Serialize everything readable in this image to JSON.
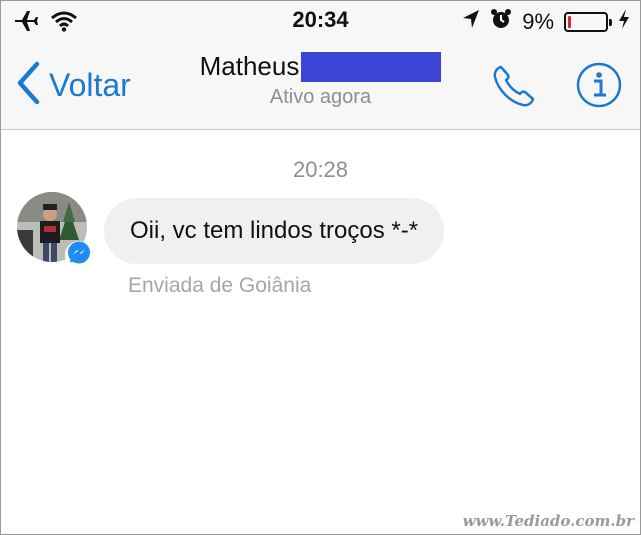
{
  "status_bar": {
    "time": "20:34",
    "battery_percent_text": "9%",
    "battery_level": 0.09,
    "icons": [
      "airplane-icon",
      "wifi-icon",
      "location-arrow-icon",
      "alarm-clock-icon",
      "charging-bolt-icon"
    ]
  },
  "header": {
    "back_label": "Voltar",
    "contact_name": "Matheus",
    "contact_status": "Ativo agora",
    "redaction_color": "#3b45d6",
    "call_icon": "phone-icon",
    "info_icon": "info-icon"
  },
  "conversation": {
    "timestamp": "20:28",
    "messages": [
      {
        "text": "Oii, vc tem lindos troços *-*",
        "location_note": "Enviada de Goiânia"
      }
    ]
  },
  "watermark": "www.Tediado.com.br",
  "colors": {
    "accent": "#1b7acf",
    "bubble": "#f1f0f0",
    "battery_low": "#e0262d",
    "messenger": "#1e8cf2"
  }
}
